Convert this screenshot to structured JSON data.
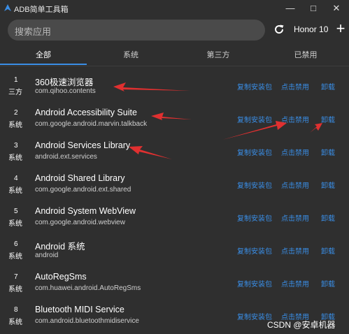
{
  "window": {
    "title": "ADB简单工具箱",
    "minimize": "—",
    "maximize": "□",
    "close": "✕"
  },
  "search": {
    "placeholder": "搜索应用"
  },
  "device": {
    "name": "Honor 10"
  },
  "add_label": "+",
  "tabs": [
    {
      "label": "全部",
      "active": true
    },
    {
      "label": "系统",
      "active": false
    },
    {
      "label": "第三方",
      "active": false
    },
    {
      "label": "已禁用",
      "active": false
    }
  ],
  "actions": {
    "copy": "复制安装包",
    "disable": "点击禁用",
    "uninstall": "卸载"
  },
  "apps": [
    {
      "num": "1",
      "type": "三方",
      "name": "360极速浏览器",
      "pkg": "com.qihoo.contents"
    },
    {
      "num": "2",
      "type": "系统",
      "name": "Android Accessibility Suite",
      "pkg": "com.google.android.marvin.talkback"
    },
    {
      "num": "3",
      "type": "系统",
      "name": "Android Services Library",
      "pkg": "android.ext.services"
    },
    {
      "num": "4",
      "type": "系统",
      "name": "Android Shared Library",
      "pkg": "com.google.android.ext.shared"
    },
    {
      "num": "5",
      "type": "系统",
      "name": "Android System WebView",
      "pkg": "com.google.android.webview"
    },
    {
      "num": "6",
      "type": "系统",
      "name": "Android 系统",
      "pkg": "android"
    },
    {
      "num": "7",
      "type": "系统",
      "name": "AutoRegSms",
      "pkg": "com.huawei.android.AutoRegSms"
    },
    {
      "num": "8",
      "type": "系统",
      "name": "Bluetooth MIDI Service",
      "pkg": "com.android.bluetoothmidiservice"
    }
  ],
  "watermark": "CSDN @安卓机器",
  "colors": {
    "background": "#2f2f2f",
    "accent": "#3a8ee6",
    "annotation": "#e03030",
    "search_bg": "#4a4a4a"
  }
}
